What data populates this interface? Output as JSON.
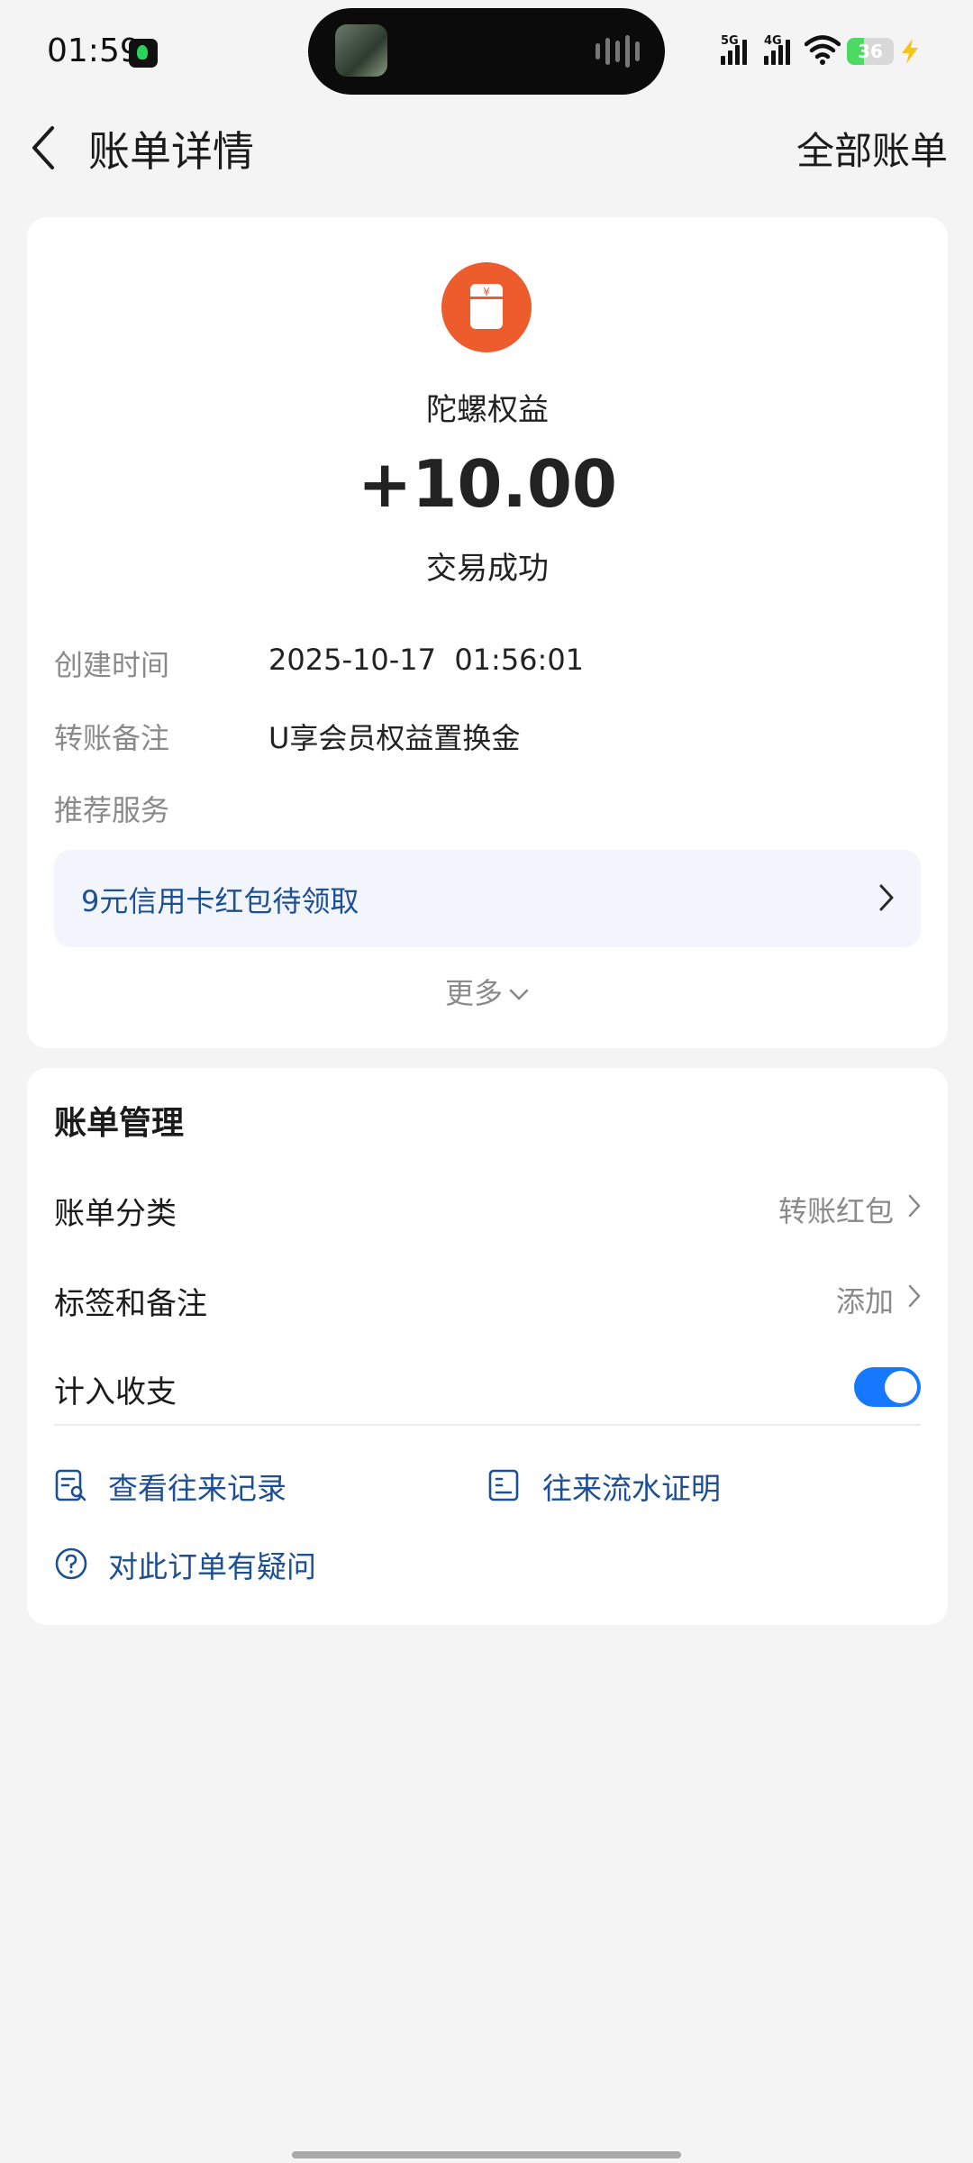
{
  "status_bar": {
    "time": "01:59",
    "network_1": "5G",
    "network_2": "4G",
    "battery": "36",
    "battery_level": 0.36,
    "battery_color": "#4cd964"
  },
  "header": {
    "title": "账单详情",
    "right_action": "全部账单"
  },
  "transaction": {
    "icon": "red-envelope-icon",
    "icon_color": "#ec5c2c",
    "merchant": "陀螺权益",
    "amount": "+10.00",
    "status": "交易成功"
  },
  "details": {
    "created_label": "创建时间",
    "created_value": "2025-10-17  01:56:01",
    "note_label": "转账备注",
    "note_value": "U享会员权益置换金",
    "services_label": "推荐服务"
  },
  "promo": {
    "text": "9元信用卡红包待领取"
  },
  "more_label": "更多",
  "management": {
    "title": "账单管理",
    "category_label": "账单分类",
    "category_value": "转账红包",
    "tags_label": "标签和备注",
    "tags_value": "添加",
    "include_label": "计入收支",
    "include_on": true,
    "toggle_color": "#1677ff"
  },
  "links": {
    "history": "查看往来记录",
    "certificate": "往来流水证明",
    "question": "对此订单有疑问"
  },
  "colors": {
    "background": "#f4f4f5",
    "link": "#1d4f95",
    "secondary_text": "#8a8a8a"
  }
}
